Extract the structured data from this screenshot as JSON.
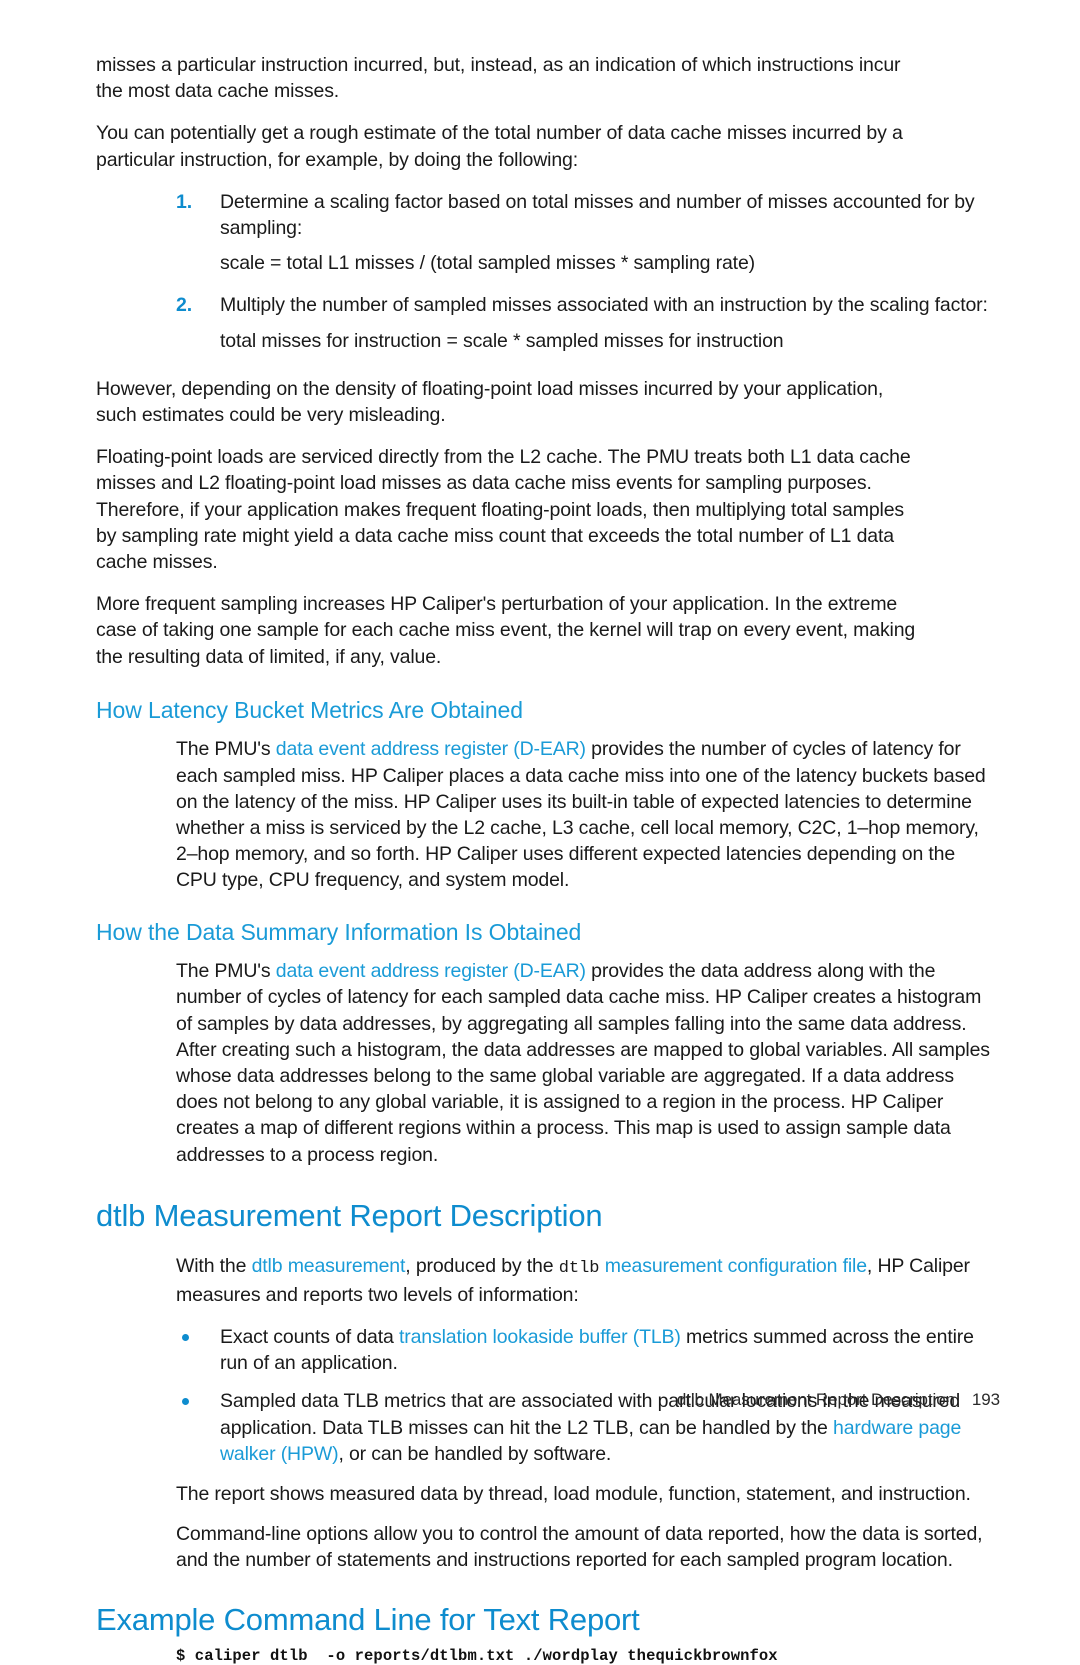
{
  "page": {
    "accent_blue": "#1a9bd7",
    "heading_blue": "#0e8cce",
    "body_color": "#1a1a1a"
  },
  "body": {
    "para_1": "misses a particular instruction incurred, but, instead, as an indication of which instructions incur the most data cache misses.",
    "para_2": "You can potentially get a rough estimate of the total number of data cache misses incurred by a particular instruction, for example, by doing the following:",
    "steps": [
      {
        "marker": "1.",
        "text": "Determine a scaling factor based on total misses and number of misses accounted for by sampling:",
        "sub": "scale = total L1 misses / (total sampled misses * sampling rate)"
      },
      {
        "marker": "2.",
        "text": "Multiply the number of sampled misses associated with an instruction by the scaling factor:",
        "sub": "total misses for instruction = scale * sampled misses for instruction"
      }
    ],
    "para_3": "However, depending on the density of floating-point load misses incurred by your application, such estimates could be very misleading.",
    "para_4": "Floating-point loads are serviced directly from the L2 cache. The PMU treats both L1 data cache misses and L2 floating-point load misses as data cache miss events for sampling purposes. Therefore, if your application makes frequent floating-point loads, then multiplying total samples by sampling rate might yield a data cache miss count that exceeds the total number of L1 data cache misses.",
    "para_5": "More frequent sampling increases HP Caliper's perturbation of your application. In the extreme case of taking one sample for each cache miss event, the kernel will trap on every event, making the resulting data of limited, if any, value."
  },
  "section_latency": {
    "heading": "How Latency Bucket Metrics Are Obtained",
    "para_prefix": "The PMU's ",
    "link": "data event address register (D-EAR)",
    "para_rest": " provides the number of cycles of latency for each sampled miss. HP Caliper places a data cache miss into one of the latency buckets based on the latency of the miss. HP Caliper uses its built-in table of expected latencies to determine whether a miss is serviced by the L2 cache, L3 cache, cell local memory, C2C, 1–hop memory, 2–hop memory, and so forth. HP Caliper uses different expected latencies depending on the CPU type, CPU frequency, and system model."
  },
  "section_summary": {
    "heading": "How the Data Summary Information Is Obtained",
    "para_prefix": "The PMU's ",
    "link": "data event address register (D-EAR)",
    "para_rest": " provides the data address along with the number of cycles of latency for each sampled data cache miss. HP Caliper creates a histogram of samples by data addresses, by aggregating all samples falling into the same data address. After creating such a histogram, the data addresses are mapped to global variables. All samples whose data addresses belong to the same global variable are aggregated. If a data address does not belong to any global variable, it is assigned to a region in the process. HP Caliper creates a map of different regions within a process. This map is used to assign sample data addresses to a process region."
  },
  "section_dtlb": {
    "heading": "dtlb Measurement Report Description",
    "intro_1": "With the ",
    "intro_link_1": "dtlb measurement",
    "intro_2": ", produced by the ",
    "intro_mono": "dtlb",
    "intro_link_2": " measurement configuration file",
    "intro_3": ", HP Caliper measures and reports two levels of information:",
    "bullets": [
      {
        "prefix": "Exact counts of data ",
        "link": "translation lookaside buffer (TLB)",
        "suffix": " metrics summed across the entire run of an application."
      },
      {
        "prefix": "Sampled data TLB metrics that are associated with particular locations in the measured application. Data TLB misses can hit the L2 TLB, can be handled by the ",
        "link": "hardware page walker (HPW)",
        "suffix": ", or can be handled by software."
      }
    ],
    "para_after_1": "The report shows measured data by thread, load module, function, statement, and instruction.",
    "para_after_2": "Command-line options allow you to control the amount of data reported, how the data is sorted, and the number of statements and instructions reported for each sampled program location."
  },
  "section_example": {
    "heading": "Example Command Line for Text Report",
    "command": "$ caliper dtlb  -o reports/dtlbm.txt ./wordplay thequickbrownfox"
  },
  "footer": {
    "title": "dtlb Measurement Report Description",
    "page_number": "193"
  }
}
